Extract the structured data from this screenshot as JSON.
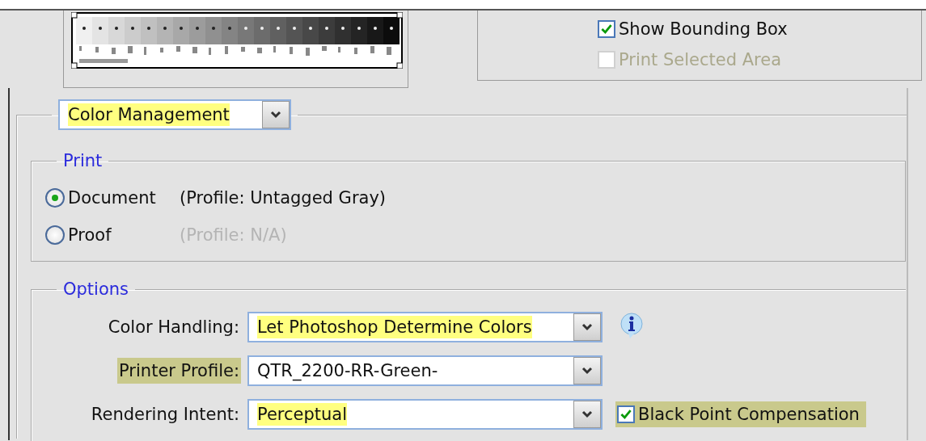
{
  "top_options": [
    {
      "label": "Show Bounding Box",
      "checked": true,
      "disabled": false
    },
    {
      "label": "Print Selected Area",
      "checked": false,
      "disabled": true
    }
  ],
  "section_dropdown": {
    "value": "Color Management",
    "highlight": {
      "color": "#ffff80"
    }
  },
  "print_group": {
    "title": "Print",
    "choices": [
      {
        "label": "Document",
        "selected": true,
        "profile": "(Profile: Untagged Gray)",
        "profile_disabled": false
      },
      {
        "label": "Proof",
        "selected": false,
        "profile": "(Profile: N/A)",
        "profile_disabled": true
      }
    ]
  },
  "options_group": {
    "title": "Options",
    "rows": [
      {
        "label": "Color Handling:",
        "value": "Let Photoshop Determine Colors",
        "value_highlight": {
          "color": "#ffff80"
        },
        "extra": {
          "kind": "info"
        }
      },
      {
        "label": "Printer Profile:",
        "label_highlight": {
          "color": "#c9c98c"
        },
        "value": "QTR_2200-RR-Green-"
      },
      {
        "label": "Rendering Intent:",
        "value": "Perceptual",
        "value_highlight": {
          "color": "#ffff80"
        },
        "extra": {
          "kind": "checkbox",
          "label": "Black Point Compensation",
          "checked": true,
          "highlight": {
            "color": "#c9c98c"
          }
        }
      }
    ]
  }
}
